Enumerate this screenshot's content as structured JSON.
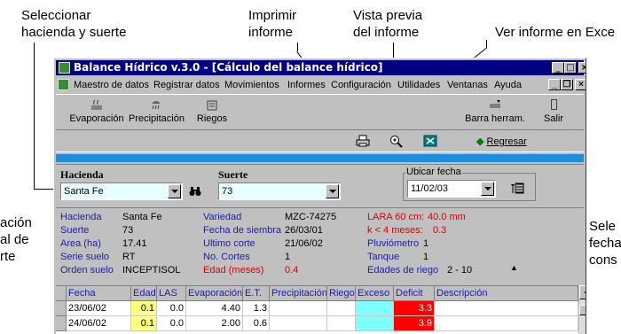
{
  "callouts": {
    "seleccionar_line1": "Seleccionar",
    "seleccionar_line2": "hacienda y suerte",
    "imprimir_line1": "Imprimir",
    "imprimir_line2": "informe",
    "vista_line1": "Vista previa",
    "vista_line2": "del informe",
    "excel": "Ver informe en Exce",
    "left_line1": "ación",
    "left_line2": "al de",
    "left_line3": "rte",
    "right_line1": "Sele",
    "right_line2": "fecha",
    "right_line3": "cons"
  },
  "window": {
    "title": "Balance Hídrico  v.3.0 - [Cálculo del balance hídrico]",
    "buttons": {
      "minimize": "_",
      "maximize": "□",
      "close": "×"
    },
    "mdi_buttons": {
      "minimize": "_",
      "restore": "❐",
      "close": "×"
    }
  },
  "menu": [
    "Maestro de datos",
    "Registrar datos",
    "Movimientos",
    "Informes",
    "Configuración",
    "Utilidades",
    "Ventanas",
    "Ayuda"
  ],
  "toolbar": {
    "evaporacion": "Evaporación",
    "precipitacion": "Precipitación",
    "riegos": "Riegos",
    "barra_herram": "Barra herram.",
    "salir": "Salir"
  },
  "secondary_bar": {
    "regresar": "Regresar"
  },
  "selection": {
    "hacienda_label": "Hacienda",
    "hacienda_value": "Santa Fe",
    "suerte_label": "Suerte",
    "suerte_value": "73",
    "ubicar_label": "Ubicar fecha",
    "ubicar_value": "11/02/03"
  },
  "info": {
    "hacienda_label": "Hacienda",
    "hacienda_value": "Santa Fe",
    "suerte_label": "Suerte",
    "suerte_value": "73",
    "area_label": "Area (ha)",
    "area_value": "17.41",
    "serie_label": "Serie suelo",
    "serie_value": "RT",
    "orden_label": "Orden suelo",
    "orden_value": "INCEPTISOL",
    "variedad_label": "Variedad",
    "variedad_value": "MZC-74275",
    "siembra_label": "Fecha de siembra",
    "siembra_value": "26/03/01",
    "corte_label": "Ultimo corte",
    "corte_value": "21/06/02",
    "ncortes_label": "No. Cortes",
    "ncortes_value": "1",
    "edad_label": "Edad (meses)",
    "edad_value": "0.4",
    "lara_label": "LARA 60 cm:",
    "lara_value": "40.0 mm",
    "k_label": "k < 4  meses:",
    "k_value": "0.3",
    "pluvio_label": "Pluviómetro",
    "pluvio_value": "1",
    "tanque_label": "Tanque",
    "tanque_value": "1",
    "edades_label": "Edades de riego",
    "edades_value": "2  - 10"
  },
  "grid": {
    "headers": [
      "Fecha",
      "Edad",
      "LAS",
      "Evaporación",
      "E.T.",
      "Precipitación",
      "Riego",
      "Exceso",
      "Deficit",
      "Descripción"
    ],
    "rows": [
      [
        "23/06/02",
        "0.1",
        "0.0",
        "4.40",
        "1.3",
        "",
        "",
        "",
        "3.3",
        ""
      ],
      [
        "24/06/02",
        "0.1",
        "0.0",
        "2.00",
        "0.6",
        "",
        "",
        "",
        "3.9",
        ""
      ]
    ]
  },
  "colors": {
    "titlebar": "#000080",
    "accent_bar": "#1e8fe0",
    "deficit": "#ff0000",
    "exceso": "#80ffff",
    "edad": "#ffff80"
  }
}
